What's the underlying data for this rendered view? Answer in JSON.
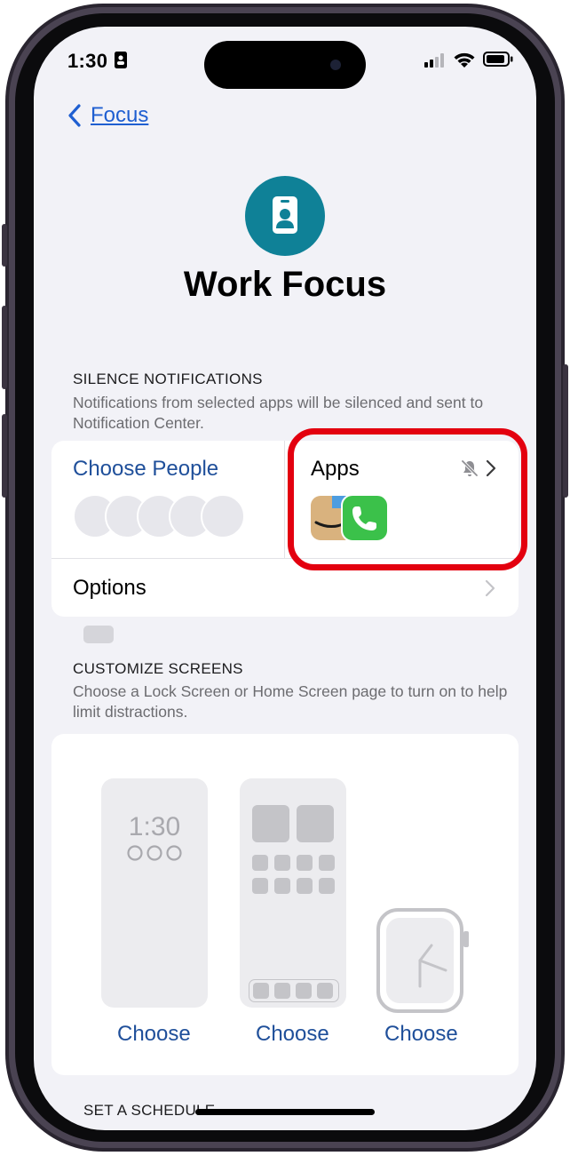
{
  "status_bar": {
    "time": "1:30"
  },
  "nav": {
    "back_label": "Focus"
  },
  "header": {
    "title": "Work Focus"
  },
  "silence": {
    "heading": "SILENCE NOTIFICATIONS",
    "description": "Notifications from selected apps will be silenced and sent to Notification Center.",
    "people_label": "Choose People",
    "apps_label": "Apps",
    "options_label": "Options"
  },
  "customize": {
    "heading": "CUSTOMIZE SCREENS",
    "description": "Choose a Lock Screen or Home Screen page to turn on to help limit distractions.",
    "lock_time": "1:30",
    "choose_lock": "Choose",
    "choose_home": "Choose",
    "choose_watch": "Choose"
  },
  "schedule": {
    "heading_partial": "SET A SCHEDULE"
  },
  "colors": {
    "accent": "#1f4f9a",
    "highlight": "#e3000f",
    "focus_icon": "#0f8197"
  }
}
